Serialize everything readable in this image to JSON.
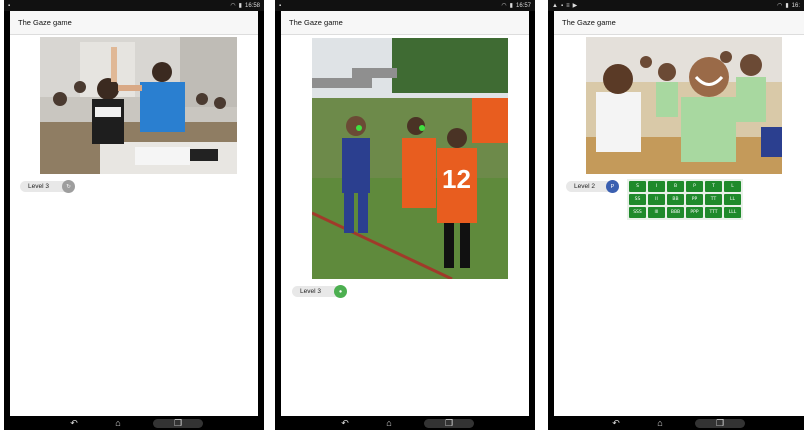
{
  "app_title": "The Gaze game",
  "screens": [
    {
      "status_time": "16:58",
      "level_label": "Level 3",
      "badge_glyph": "↻",
      "badge_color": "#9e9e9e"
    },
    {
      "status_time": "16:57",
      "level_label": "Level 3",
      "badge_glyph": "●",
      "badge_color": "#4caf50"
    },
    {
      "status_time": "16:",
      "level_label": "Level 2",
      "badge_glyph": "P",
      "badge_color": "#3a5fb0",
      "keys": [
        "S",
        "I",
        "B",
        "P",
        "T",
        "L",
        "SS",
        "II",
        "BB",
        "PP",
        "TT",
        "LL",
        "SSS",
        "III",
        "BBB",
        "PPP",
        "TTT",
        "LLL"
      ]
    }
  ],
  "nav_icons": [
    "back-icon",
    "home-icon",
    "recent-apps-icon"
  ],
  "colors": {
    "key_green": "#1f8a2b",
    "app_bar": "#f7f7f7",
    "frame": "#000000"
  }
}
